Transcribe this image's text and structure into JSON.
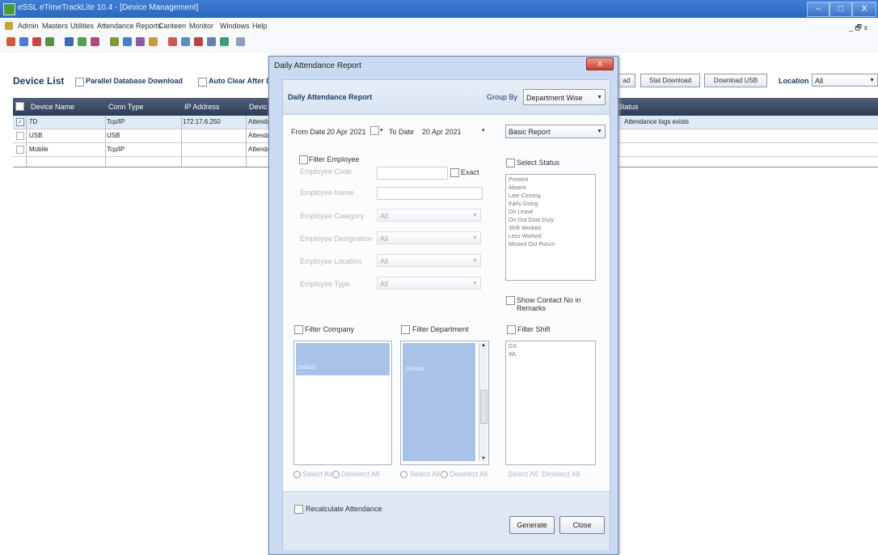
{
  "window": {
    "title": "eSSL eTimeTrackLite 10.4 - [Device Management]",
    "controls": [
      "–",
      "□",
      "X"
    ]
  },
  "menu": [
    "Admin",
    "Masters",
    "Utilities",
    "Attendance Reports",
    "Canteen",
    "Monitor",
    "Windows",
    "Help"
  ],
  "mdi_controls": "_ 🗗 x",
  "device_list": {
    "title": "Device List",
    "parallel_db_label": "Parallel Database Download",
    "auto_clear_label": "Auto Clear After D",
    "start_download": "Stat Download",
    "download_usb": "Download USB",
    "location_label": "Location",
    "location_value": "All",
    "columns": [
      "Device Name",
      "Conn Type",
      "IP Address",
      "Devic",
      "Status"
    ],
    "rows": [
      {
        "name": "7D",
        "conn": "Tcp/IP",
        "ip": "172.17.6.250",
        "device": "Attenda",
        "status": "Attendance logs exists",
        "checked": true
      },
      {
        "name": "USB",
        "conn": "USB",
        "ip": "",
        "device": "Attenda",
        "status": "",
        "checked": false
      },
      {
        "name": "Mobile",
        "conn": "Tcp/IP",
        "ip": "",
        "device": "Attenda",
        "status": "",
        "checked": false
      }
    ]
  },
  "dialog": {
    "title": "Daily Attendance Report",
    "close": "X",
    "header": "Daily Attendance Report",
    "group_by_label": "Group By",
    "group_by_value": "Department Wise",
    "from_date_label": "From Date",
    "from_date_value": "20 Apr 2021",
    "to_date_label": "To Date",
    "to_date_value": "20 Apr 2021",
    "report_type": "Basic Report",
    "filter_employee": "Filter Employee",
    "employee_code": "Employee Code",
    "exact": "Exact",
    "employee_name": "Employee Name",
    "employee_category": "Employee Category",
    "category_value": "All",
    "employee_designation": "Employee Designation",
    "designation_value": "All",
    "employee_location": "Employee Location",
    "location_value": "All",
    "employee_type": "Employee Type",
    "type_value": "All",
    "select_status": "Select Status",
    "status_items": [
      "Present",
      "Absent",
      "Late Coming",
      "Early Going",
      "On Leave",
      "On Out Door Duty",
      "Shift Worked",
      "Less Worked",
      "Missed Out Punch"
    ],
    "show_contact": "Show Contact No in Remarks",
    "filter_company": "Filter Company",
    "filter_department": "Filter Department",
    "filter_shift": "Filter Shift",
    "company_items": [
      "Default"
    ],
    "department_items": [
      "Default"
    ],
    "shift_items": [
      "GS",
      "WL"
    ],
    "select_all": "Select All",
    "deselect_all": "Deselect All",
    "recalculate": "Recalculate Attendance",
    "generate": "Generate",
    "close_button": "Close"
  }
}
